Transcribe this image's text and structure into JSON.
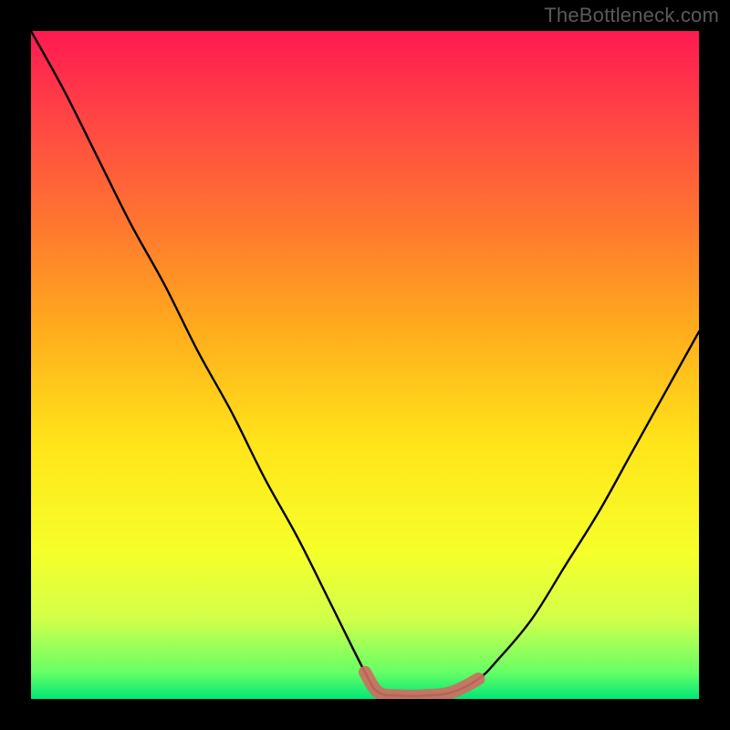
{
  "watermark": "TheBottleneck.com",
  "chart_data": {
    "type": "line",
    "title": "",
    "xlabel": "",
    "ylabel": "",
    "xlim": [
      0,
      100
    ],
    "ylim": [
      0,
      100
    ],
    "grid": false,
    "legend": false,
    "series": [
      {
        "name": "main-curve",
        "color": "#000000",
        "x": [
          0,
          5,
          10,
          15,
          20,
          25,
          30,
          35,
          40,
          45,
          50,
          52,
          55,
          59,
          63,
          67,
          70,
          75,
          80,
          85,
          90,
          95,
          100
        ],
        "y": [
          100,
          91,
          81,
          71,
          62,
          52,
          43,
          33,
          24,
          14,
          4,
          1,
          0.5,
          0.5,
          1,
          3,
          6,
          12,
          20,
          28,
          37,
          46,
          55
        ]
      },
      {
        "name": "base-highlight",
        "color": "#cf6b62",
        "x": [
          50,
          52,
          55,
          59,
          63,
          67
        ],
        "y": [
          4,
          1,
          0.5,
          0.5,
          1,
          3
        ]
      }
    ]
  }
}
